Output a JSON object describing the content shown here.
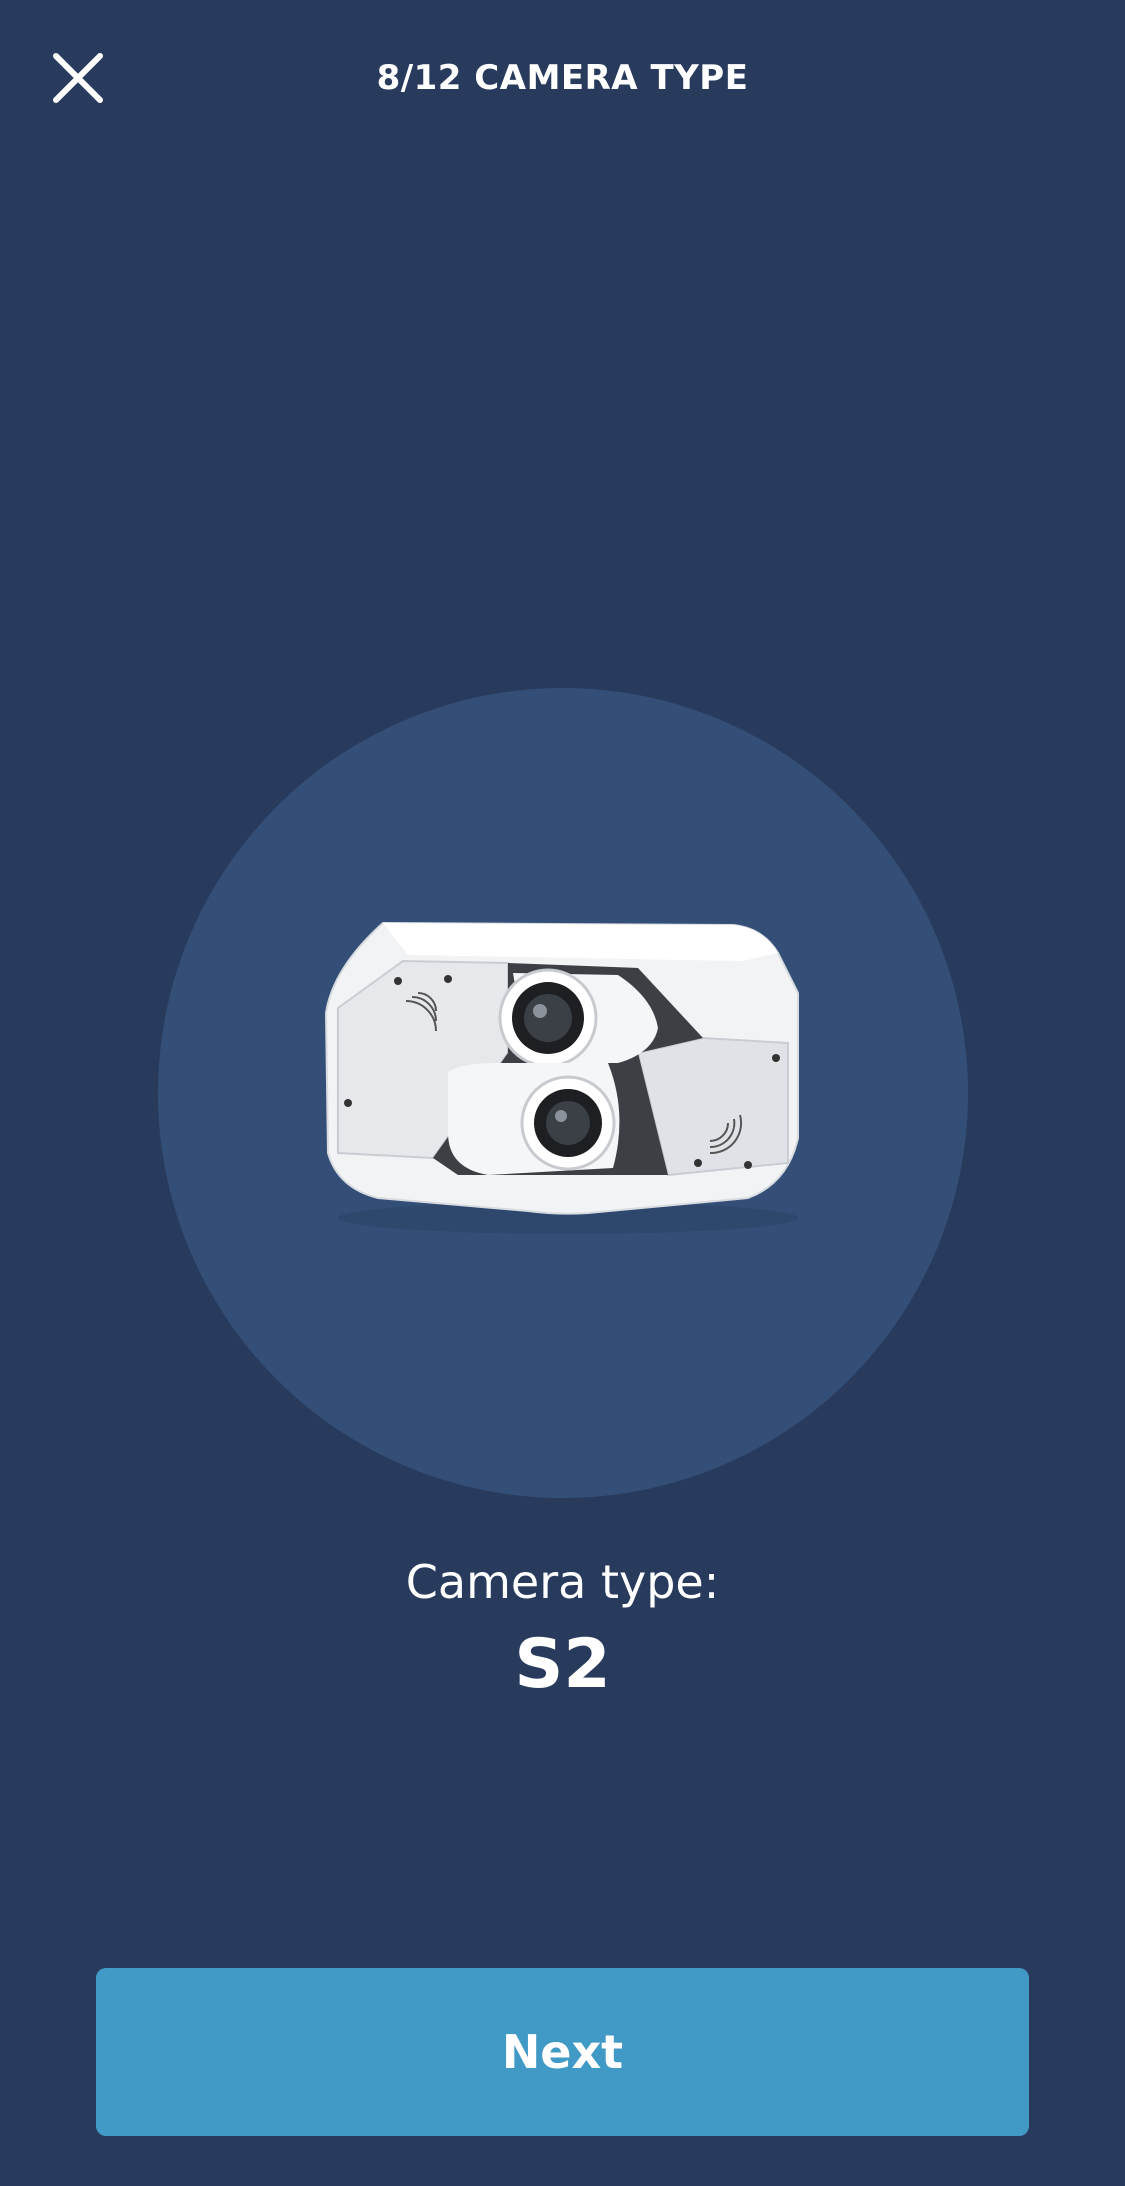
{
  "header": {
    "title": "8/12 CAMERA TYPE",
    "close_icon": "close-icon"
  },
  "hero": {
    "image": "dual-lens-camera-image"
  },
  "camera": {
    "label": "Camera type:",
    "value": "S2"
  },
  "footer": {
    "next_label": "Next"
  },
  "colors": {
    "background": "#283b5d",
    "circle": "#344f77",
    "accent": "#4199c6",
    "text": "#ffffff"
  }
}
